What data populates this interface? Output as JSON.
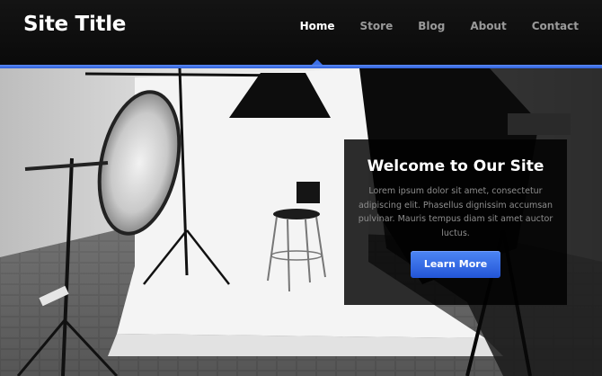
{
  "header": {
    "site_title": "Site Title",
    "nav": [
      {
        "label": "Home",
        "active": true
      },
      {
        "label": "Store",
        "active": false
      },
      {
        "label": "Blog",
        "active": false
      },
      {
        "label": "About",
        "active": false
      },
      {
        "label": "Contact",
        "active": false
      }
    ]
  },
  "hero": {
    "image_icon": "photo-studio-image",
    "heading": "Welcome to Our Site",
    "body": "Lorem ipsum dolor sit amet, consectetur adipiscing elit. Phasellus dignissim accumsan pulvinar. Mauris tempus diam sit amet auctor luctus.",
    "button_label": "Learn More"
  },
  "colors": {
    "accent": "#3c6fe6",
    "header_bg": "#0f0f0f",
    "button": "#3d74ee"
  }
}
